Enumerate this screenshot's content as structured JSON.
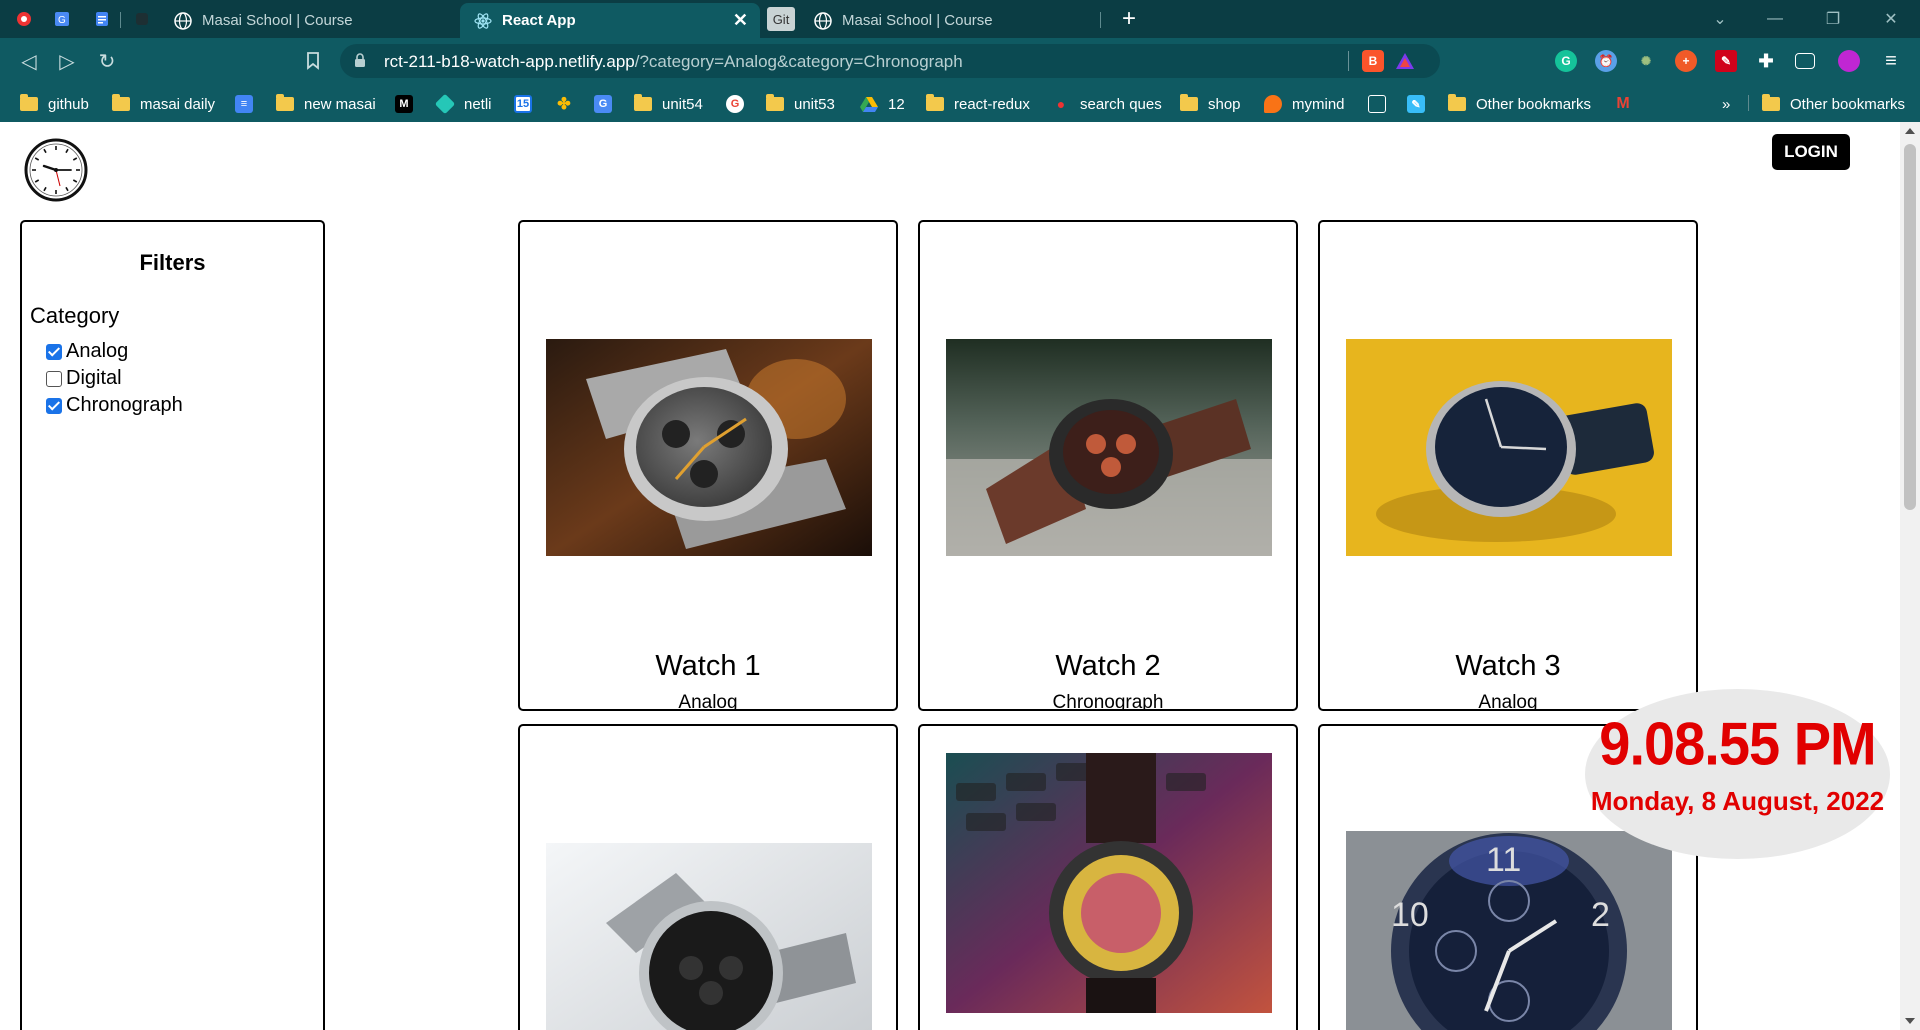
{
  "browser": {
    "tabs": [
      {
        "title": "Masai School | Course",
        "active": false
      },
      {
        "title": "React App",
        "active": true
      },
      {
        "title": "Masai School | Course",
        "active": false
      }
    ],
    "git_tab_label": "Git",
    "new_tab_symbol": "+",
    "url_host": "rct-211-b18-watch-app.netlify.app",
    "url_path": "/?category=Analog&category=Chronograph",
    "bookmarks": [
      {
        "label": "github",
        "icon": "folder-icon"
      },
      {
        "label": "masai daily",
        "icon": "folder-icon"
      },
      {
        "label": "",
        "icon": "google-docs-icon"
      },
      {
        "label": "new masai",
        "icon": "folder-icon"
      },
      {
        "label": "",
        "icon": "medium-icon"
      },
      {
        "label": "netli",
        "icon": "netlify-icon"
      },
      {
        "label": "",
        "icon": "calendar-icon"
      },
      {
        "label": "",
        "icon": "photos-icon"
      },
      {
        "label": "",
        "icon": "translate-icon"
      },
      {
        "label": "unit54",
        "icon": "folder-icon"
      },
      {
        "label": "",
        "icon": "google-icon"
      },
      {
        "label": "unit53",
        "icon": "folder-icon"
      },
      {
        "label": "12",
        "icon": "drive-icon"
      },
      {
        "label": "react-redux",
        "icon": "folder-icon"
      },
      {
        "label": "search ques",
        "icon": "chrome-icon"
      },
      {
        "label": "shop",
        "icon": "folder-icon"
      },
      {
        "label": "mymind",
        "icon": "mymind-icon"
      },
      {
        "label": "",
        "icon": "bookmark-icon"
      },
      {
        "label": "",
        "icon": "feather-icon"
      },
      {
        "label": "Other bookmarks",
        "icon": "folder-icon"
      },
      {
        "label": "",
        "icon": "gmail-icon"
      }
    ],
    "bookmarks_overflow": "»",
    "other_bookmarks": "Other bookmarks"
  },
  "app": {
    "login_label": "LOGIN",
    "filters_title": "Filters",
    "category_label": "Category",
    "categories": [
      {
        "label": "Analog",
        "checked": true
      },
      {
        "label": "Digital",
        "checked": false
      },
      {
        "label": "Chronograph",
        "checked": true
      }
    ],
    "watches": [
      {
        "name": "Watch 1",
        "category": "Analog"
      },
      {
        "name": "Watch 2",
        "category": "Chronograph"
      },
      {
        "name": "Watch 3",
        "category": "Analog"
      },
      {
        "name": "",
        "category": ""
      },
      {
        "name": "",
        "category": ""
      },
      {
        "name": "",
        "category": ""
      }
    ]
  },
  "clock_widget": {
    "time": "9.08.55 PM",
    "date": "Monday, 8 August, 2022",
    "color": "#e10000"
  },
  "colors": {
    "tabbar": "#0b3d44",
    "toolbar": "#0f5a62",
    "login_button": "#000000",
    "checkbox_checked": "#1a73e8"
  }
}
